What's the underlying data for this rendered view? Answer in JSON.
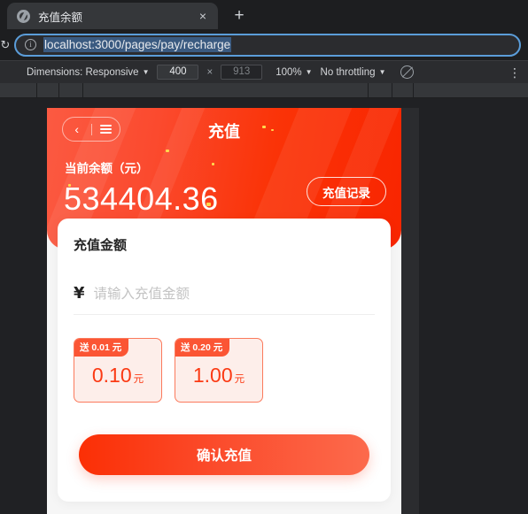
{
  "browser": {
    "tab": {
      "title": "充值余额",
      "favicon": "globe-icon",
      "close": "×"
    },
    "new_tab_label": "+",
    "reload_glyph": "↻",
    "omnibox": {
      "url": "localhost:3000/pages/pay/recharge",
      "info_glyph": "i"
    }
  },
  "devtools": {
    "dimensions_label": "Dimensions: Responsive",
    "width_value": "400",
    "height_value": "913",
    "multiply": "×",
    "zoom_label": "100%",
    "throttling_label": "No throttling",
    "caret": "▼",
    "kebab": "⋮"
  },
  "page": {
    "hero": {
      "back_glyph": "‹",
      "title": "充值",
      "balance_label": "当前余额（元）",
      "balance_value": "534404.36",
      "record_button": "充值记录"
    },
    "card": {
      "title": "充值金额",
      "currency_symbol": "¥",
      "amount_placeholder": "请输入充值金额",
      "amount_value": "",
      "presets": [
        {
          "badge": "送 0.01 元",
          "amount": "0.10",
          "unit": "元"
        },
        {
          "badge": "送 0.20 元",
          "amount": "1.00",
          "unit": "元"
        }
      ],
      "confirm_button": "确认充值"
    }
  },
  "colors": {
    "brand_red": "#fb3a14",
    "hero_gradient_start": "#fb5a42",
    "hero_gradient_end": "#f92500",
    "preset_bg": "#fdeeea",
    "preset_border": "#fb7a5c"
  }
}
